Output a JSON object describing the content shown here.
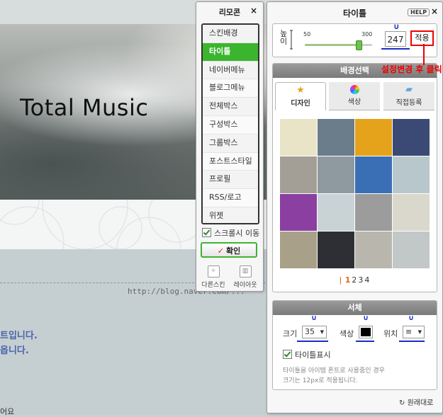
{
  "background": {
    "blog_title": "Total Music",
    "url": "http://blog.naver.com/...",
    "text_line_1": "트입니다.",
    "text_line_2": "옵니다.",
    "bottom_text": "어요"
  },
  "remote": {
    "title": "리모콘",
    "close": "×",
    "menu": [
      "스킨배경",
      "타이틀",
      "네이버메뉴",
      "블로그메뉴",
      "전체박스",
      "구성박스",
      "그룹박스",
      "포스트스타일",
      "프로필",
      "RSS/로고",
      "위젯"
    ],
    "active_index": 1,
    "scroll_move_label": "스크롤시 이동",
    "confirm_label": "확인",
    "confirm_mark": "✓",
    "other_skin_label": "다른스킨",
    "layout_label": "레이아웃"
  },
  "title_panel": {
    "title": "타이틀",
    "help": "HELP",
    "close": "×",
    "height_label_chars": [
      "높",
      "이"
    ],
    "slider_min": "50",
    "slider_max": "300",
    "slider_fraction": 0.788,
    "height_value": "247",
    "apply_label": "적용",
    "annotation": "설정변경 후 클릭",
    "annotation_mark": "∪",
    "bg_section_title": "배경선택",
    "tabs": [
      {
        "label": "디자인",
        "icon": "★"
      },
      {
        "label": "색상",
        "icon": "●"
      },
      {
        "label": "직접등록",
        "icon": "▰"
      }
    ],
    "pager": [
      "1",
      "2",
      "3",
      "4"
    ],
    "pager_current": 0,
    "font_section_title": "서체",
    "size_label": "크기",
    "size_value": "35",
    "color_label": "색상",
    "color_value": "#000000",
    "position_label": "위치",
    "position_value": "≡",
    "title_show_label": "타이틀표시",
    "note_line_1": "타이틀을 아이템 폰트로 사용중인 경우",
    "note_line_2": "크기는 12px로 적용됩니다.",
    "reset_label": "원래대로"
  },
  "thumb_colors": [
    "#e9e4c8",
    "#6b7d8a",
    "#e4a31a",
    "#3b4a74",
    "#a39f96",
    "#8e9aa0",
    "#3a6fb6",
    "#b8c7cc",
    "#8a3fa1",
    "#c9d3d6",
    "#9c9c9c",
    "#dad8cd",
    "#a8a088",
    "#2d2f34",
    "#b9b6ad",
    "#c2c8c8"
  ]
}
